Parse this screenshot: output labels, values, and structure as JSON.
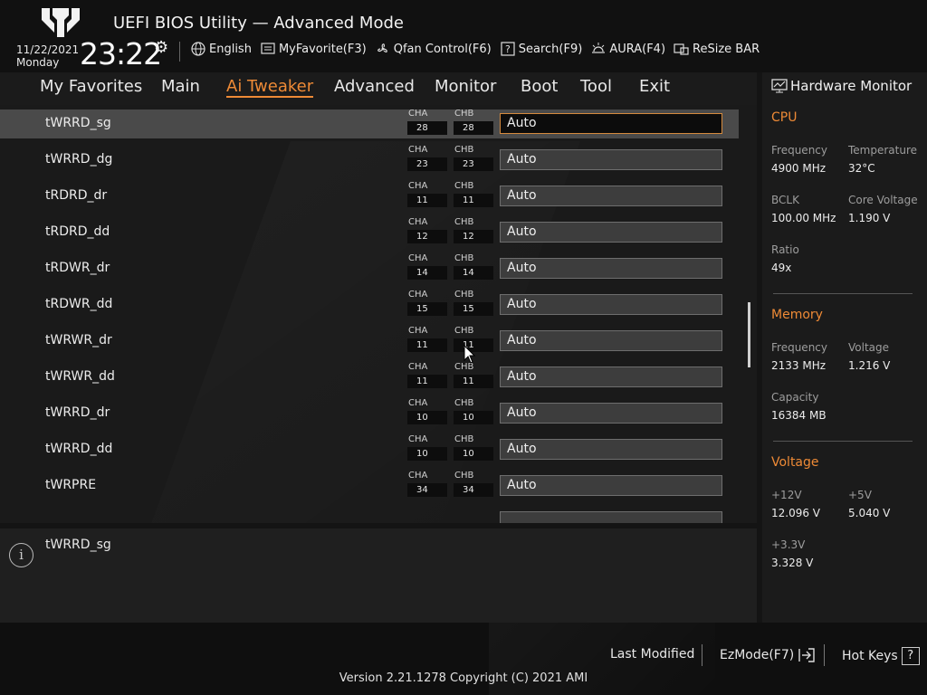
{
  "header": {
    "title": "UEFI BIOS Utility — Advanced Mode",
    "date": "11/22/2021",
    "weekday": "Monday",
    "time": "23:22",
    "tools": [
      {
        "label": "English",
        "icon": "globe-icon"
      },
      {
        "label": "MyFavorite(F3)",
        "icon": "favorite-icon"
      },
      {
        "label": "Qfan Control(F6)",
        "icon": "fan-icon"
      },
      {
        "label": "Search(F9)",
        "icon": "search-icon"
      },
      {
        "label": "AURA(F4)",
        "icon": "aura-icon"
      },
      {
        "label": "ReSize BAR",
        "icon": "resize-bar-icon"
      }
    ]
  },
  "nav": {
    "tabs": [
      "My Favorites",
      "Main",
      "Ai Tweaker",
      "Advanced",
      "Monitor",
      "Boot",
      "Tool",
      "Exit"
    ],
    "active": "Ai Tweaker"
  },
  "list": {
    "cha_label": "CHA",
    "chb_label": "CHB",
    "rows": [
      {
        "name": "tWRRD_sg",
        "cha": "28",
        "chb": "28",
        "value": "Auto"
      },
      {
        "name": "tWRRD_dg",
        "cha": "23",
        "chb": "23",
        "value": "Auto"
      },
      {
        "name": "tRDRD_dr",
        "cha": "11",
        "chb": "11",
        "value": "Auto"
      },
      {
        "name": "tRDRD_dd",
        "cha": "12",
        "chb": "12",
        "value": "Auto"
      },
      {
        "name": "tRDWR_dr",
        "cha": "14",
        "chb": "14",
        "value": "Auto"
      },
      {
        "name": "tRDWR_dd",
        "cha": "15",
        "chb": "15",
        "value": "Auto"
      },
      {
        "name": "tWRWR_dr",
        "cha": "11",
        "chb": "11",
        "value": "Auto"
      },
      {
        "name": "tWRWR_dd",
        "cha": "11",
        "chb": "11",
        "value": "Auto"
      },
      {
        "name": "tWRRD_dr",
        "cha": "10",
        "chb": "10",
        "value": "Auto"
      },
      {
        "name": "tWRRD_dd",
        "cha": "10",
        "chb": "10",
        "value": "Auto"
      },
      {
        "name": "tWRPRE",
        "cha": "34",
        "chb": "34",
        "value": "Auto"
      }
    ]
  },
  "help": {
    "text": "tWRRD_sg"
  },
  "hw": {
    "title": "Hardware Monitor",
    "cpu": {
      "title": "CPU",
      "freq_label": "Frequency",
      "freq": "4900 MHz",
      "temp_label": "Temperature",
      "temp": "32°C",
      "bclk_label": "BCLK",
      "bclk": "100.00 MHz",
      "cv_label": "Core Voltage",
      "cv": "1.190 V",
      "ratio_label": "Ratio",
      "ratio": "49x"
    },
    "memory": {
      "title": "Memory",
      "freq_label": "Frequency",
      "freq": "2133 MHz",
      "volt_label": "Voltage",
      "volt": "1.216 V",
      "cap_label": "Capacity",
      "cap": "16384 MB"
    },
    "voltage": {
      "title": "Voltage",
      "v12_label": "+12V",
      "v12": "12.096 V",
      "v5_label": "+5V",
      "v5": "5.040 V",
      "v33_label": "+3.3V",
      "v33": "3.328 V"
    }
  },
  "footer": {
    "last_modified": "Last Modified",
    "ezmode": "EzMode(F7)",
    "hotkeys": "Hot Keys",
    "hotkeys_glyph": "?",
    "version": "Version 2.21.1278 Copyright (C) 2021 AMI"
  }
}
